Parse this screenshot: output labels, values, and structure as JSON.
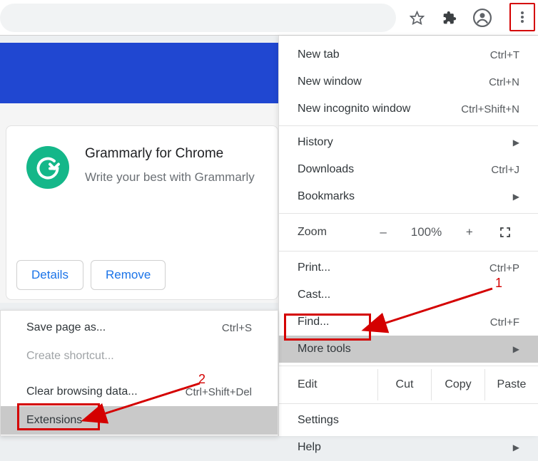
{
  "toolbar": {
    "icons": {
      "star": "star-icon",
      "puzzle": "extensions-icon",
      "profile": "profile-icon",
      "dots": "more-icon"
    }
  },
  "card": {
    "title": "Grammarly for Chrome",
    "subtitle": "Write your best with Grammarly",
    "details": "Details",
    "remove": "Remove"
  },
  "menu": {
    "new_tab": {
      "label": "New tab",
      "shortcut": "Ctrl+T"
    },
    "new_window": {
      "label": "New window",
      "shortcut": "Ctrl+N"
    },
    "incognito": {
      "label": "New incognito window",
      "shortcut": "Ctrl+Shift+N"
    },
    "history": {
      "label": "History"
    },
    "downloads": {
      "label": "Downloads",
      "shortcut": "Ctrl+J"
    },
    "bookmarks": {
      "label": "Bookmarks"
    },
    "zoom": {
      "label": "Zoom",
      "minus": "–",
      "value": "100%",
      "plus": "+"
    },
    "print": {
      "label": "Print...",
      "shortcut": "Ctrl+P"
    },
    "cast": {
      "label": "Cast..."
    },
    "find": {
      "label": "Find...",
      "shortcut": "Ctrl+F"
    },
    "more_tools": {
      "label": "More tools"
    },
    "edit": {
      "label": "Edit",
      "cut": "Cut",
      "copy": "Copy",
      "paste": "Paste"
    },
    "settings": {
      "label": "Settings"
    },
    "help": {
      "label": "Help"
    }
  },
  "submenu": {
    "save_page": {
      "label": "Save page as...",
      "shortcut": "Ctrl+S"
    },
    "create_sc": {
      "label": "Create shortcut..."
    },
    "clear_data": {
      "label": "Clear browsing data...",
      "shortcut": "Ctrl+Shift+Del"
    },
    "extensions": {
      "label": "Extensions"
    }
  },
  "annotations": {
    "one": "1",
    "two": "2"
  }
}
